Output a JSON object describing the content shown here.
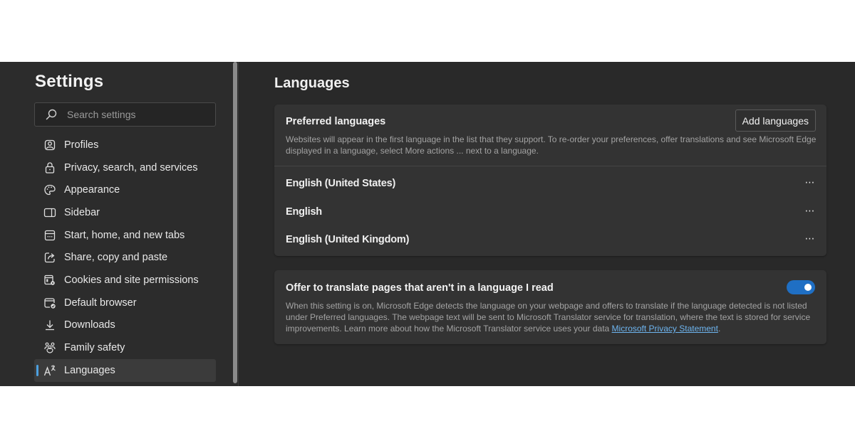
{
  "sidebar": {
    "title": "Settings",
    "search": {
      "placeholder": "Search settings",
      "value": ""
    },
    "items": [
      {
        "label": "Profiles",
        "icon": "profile-icon"
      },
      {
        "label": "Privacy, search, and services",
        "icon": "lock-icon"
      },
      {
        "label": "Appearance",
        "icon": "palette-icon"
      },
      {
        "label": "Sidebar",
        "icon": "sidebar-icon"
      },
      {
        "label": "Start, home, and new tabs",
        "icon": "home-tabs-icon"
      },
      {
        "label": "Share, copy and paste",
        "icon": "share-icon"
      },
      {
        "label": "Cookies and site permissions",
        "icon": "cookies-icon"
      },
      {
        "label": "Default browser",
        "icon": "default-browser-icon"
      },
      {
        "label": "Downloads",
        "icon": "download-icon"
      },
      {
        "label": "Family safety",
        "icon": "family-icon"
      },
      {
        "label": "Languages",
        "icon": "languages-icon",
        "active": true
      }
    ]
  },
  "main": {
    "title": "Languages",
    "preferred": {
      "title": "Preferred languages",
      "description": "Websites will appear in the first language in the list that they support. To re-order your preferences, offer translations and see Microsoft Edge displayed in a language, select More actions ... next to a language.",
      "add_button": "Add languages",
      "languages": [
        {
          "name": "English (United States)",
          "more": "⋯"
        },
        {
          "name": "English",
          "more": "⋯"
        },
        {
          "name": "English (United Kingdom)",
          "more": "⋯"
        }
      ]
    },
    "translate": {
      "title": "Offer to translate pages that aren't in a language I read",
      "description": "When this setting is on, Microsoft Edge detects the language on your webpage and offers to translate if the language detected is not listed under Preferred languages. The webpage text will be sent to Microsoft Translator service for translation, where the text is stored for service improvements. Learn more about how the Microsoft Translator service uses your data ",
      "link_text": "Microsoft Privacy Statement",
      "link_suffix": ".",
      "toggle_on": true
    }
  },
  "colors": {
    "accent": "#1f6fc4",
    "active_indicator": "#4ca0e0",
    "link": "#6eb5f0"
  }
}
